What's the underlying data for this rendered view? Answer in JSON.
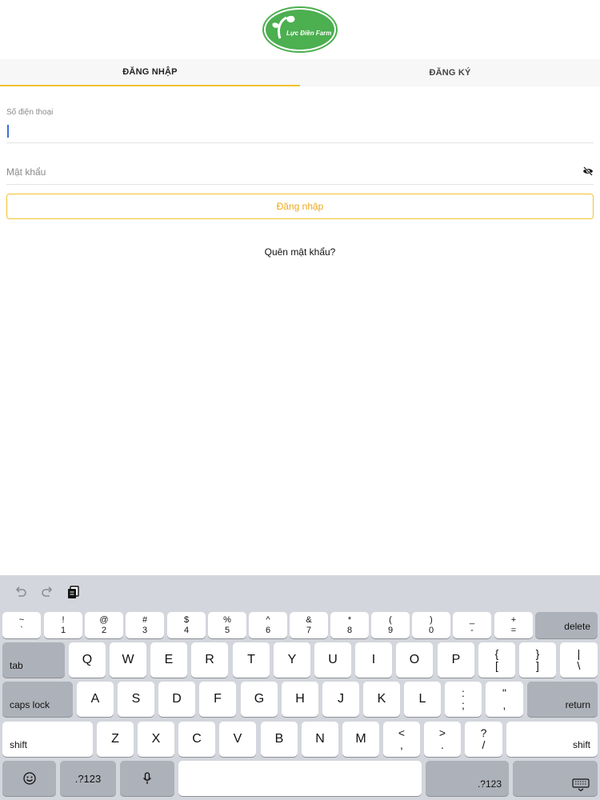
{
  "logo": {
    "text": "Lực Điền Farm",
    "color": "#4caf50"
  },
  "tabs": [
    {
      "label": "ĐĂNG NHẬP",
      "active": true
    },
    {
      "label": "ĐĂNG KÝ",
      "active": false
    }
  ],
  "form": {
    "phone_label": "Số điện thoại",
    "phone_value": "",
    "password_placeholder": "Mật khẩu",
    "password_value": "",
    "login_button": "Đăng nhập",
    "forgot_link": "Quên mật khẩu?",
    "accent_color": "#f2c230"
  },
  "keyboard": {
    "toolbar": [
      "undo-icon",
      "redo-icon",
      "paste-icon"
    ],
    "row1": [
      {
        "top": "~",
        "bottom": "`"
      },
      {
        "top": "!",
        "bottom": "1"
      },
      {
        "top": "@",
        "bottom": "2"
      },
      {
        "top": "#",
        "bottom": "3"
      },
      {
        "top": "$",
        "bottom": "4"
      },
      {
        "top": "%",
        "bottom": "5"
      },
      {
        "top": "^",
        "bottom": "6"
      },
      {
        "top": "&",
        "bottom": "7"
      },
      {
        "top": "*",
        "bottom": "8"
      },
      {
        "top": "(",
        "bottom": "9"
      },
      {
        "top": ")",
        "bottom": "0"
      },
      {
        "top": "_",
        "bottom": "-"
      },
      {
        "top": "+",
        "bottom": "="
      }
    ],
    "delete": "delete",
    "tab": "tab",
    "row2": [
      "Q",
      "W",
      "E",
      "R",
      "T",
      "Y",
      "U",
      "I",
      "O",
      "P"
    ],
    "row2_extra": [
      {
        "top": "{",
        "bottom": "["
      },
      {
        "top": "}",
        "bottom": "]"
      },
      {
        "top": "|",
        "bottom": "\\"
      }
    ],
    "caps": "caps lock",
    "row3": [
      "A",
      "S",
      "D",
      "F",
      "G",
      "H",
      "J",
      "K",
      "L"
    ],
    "row3_extra": [
      {
        "top": ":",
        "bottom": ";"
      },
      {
        "top": "\"",
        "bottom": ","
      }
    ],
    "return": "return",
    "shift": "shift",
    "row4": [
      "Z",
      "X",
      "C",
      "V",
      "B",
      "N",
      "M"
    ],
    "row4_extra": [
      {
        "top": "<",
        "bottom": ","
      },
      {
        "top": ">",
        "bottom": "."
      },
      {
        "top": "?",
        "bottom": "/"
      }
    ],
    "numbers_label": ".?123"
  }
}
